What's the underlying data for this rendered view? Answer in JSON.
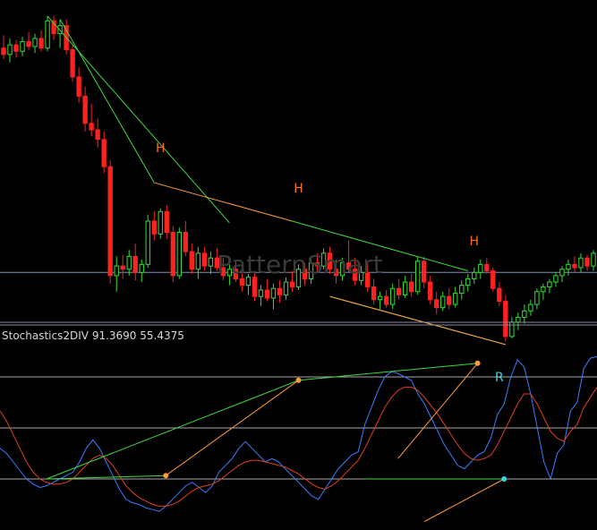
{
  "watermark": "PatternSmart",
  "colors": {
    "background": "#000000",
    "bull": "#33e033",
    "bear": "#ff2020",
    "divergence_green": "#3fdc3f",
    "divergence_orange": "#ff9a3c",
    "h_label": "#ff6a1a",
    "r_label": "#33d6e6",
    "stoch_main": "#3a7dff",
    "stoch_signal": "#e0401e",
    "level_line": "#c8c8c8",
    "separator": "#8a8aa8",
    "watermark": "#3a3a3a"
  },
  "chart_data": [
    {
      "type": "candlestick",
      "title": "",
      "xlabel": "",
      "ylabel": "",
      "ylim": [
        88,
        108
      ],
      "grid": false,
      "horizontal_line": 91.0,
      "candles": [
        [
          105.0,
          105.8,
          104.3,
          104.6
        ],
        [
          104.6,
          105.6,
          104.1,
          105.2
        ],
        [
          105.2,
          105.5,
          104.4,
          104.8
        ],
        [
          104.8,
          105.7,
          104.5,
          105.4
        ],
        [
          105.4,
          106.0,
          104.9,
          105.1
        ],
        [
          105.1,
          105.9,
          104.7,
          105.6
        ],
        [
          105.6,
          106.1,
          104.8,
          105.0
        ],
        [
          105.0,
          107.0,
          104.8,
          106.7
        ],
        [
          106.7,
          107.0,
          105.5,
          105.9
        ],
        [
          105.9,
          106.8,
          105.0,
          106.4
        ],
        [
          106.4,
          106.8,
          104.6,
          104.9
        ],
        [
          104.9,
          105.2,
          102.9,
          103.2
        ],
        [
          103.2,
          103.8,
          101.6,
          102.0
        ],
        [
          102.0,
          102.6,
          99.8,
          100.3
        ],
        [
          100.3,
          101.5,
          99.5,
          99.9
        ],
        [
          99.9,
          100.6,
          98.8,
          99.3
        ],
        [
          99.3,
          99.8,
          97.2,
          97.6
        ],
        [
          97.6,
          98.0,
          90.3,
          90.8
        ],
        [
          90.8,
          92.0,
          89.8,
          91.4
        ],
        [
          91.4,
          92.1,
          90.6,
          91.2
        ],
        [
          91.2,
          92.4,
          90.8,
          92.0
        ],
        [
          92.0,
          92.8,
          90.5,
          91.0
        ],
        [
          91.0,
          91.8,
          90.4,
          91.5
        ],
        [
          91.5,
          94.6,
          91.3,
          94.2
        ],
        [
          94.2,
          94.8,
          93.0,
          93.4
        ],
        [
          93.4,
          95.0,
          93.1,
          94.8
        ],
        [
          94.8,
          95.2,
          93.1,
          93.5
        ],
        [
          93.5,
          93.9,
          90.4,
          90.8
        ],
        [
          90.8,
          93.8,
          90.6,
          93.5
        ],
        [
          93.5,
          94.2,
          92.0,
          92.3
        ],
        [
          92.3,
          92.8,
          90.9,
          91.2
        ],
        [
          91.2,
          92.6,
          90.6,
          92.2
        ],
        [
          92.2,
          92.6,
          91.1,
          91.4
        ],
        [
          91.4,
          92.3,
          90.9,
          91.9
        ],
        [
          91.9,
          92.5,
          91.1,
          91.3
        ],
        [
          91.3,
          91.9,
          90.5,
          90.8
        ],
        [
          90.8,
          91.5,
          90.2,
          91.2
        ],
        [
          91.2,
          91.8,
          90.4,
          90.6
        ],
        [
          90.6,
          91.2,
          89.8,
          90.2
        ],
        [
          90.2,
          90.9,
          89.6,
          90.7
        ],
        [
          90.7,
          91.1,
          89.2,
          89.5
        ],
        [
          89.5,
          90.2,
          88.9,
          89.9
        ],
        [
          89.9,
          90.6,
          89.2,
          89.4
        ],
        [
          89.4,
          90.3,
          88.7,
          90.0
        ],
        [
          90.0,
          90.5,
          89.1,
          89.6
        ],
        [
          89.6,
          90.7,
          89.3,
          90.4
        ],
        [
          90.4,
          91.1,
          89.8,
          90.1
        ],
        [
          90.1,
          91.5,
          89.9,
          91.2
        ],
        [
          91.2,
          91.6,
          90.2,
          90.6
        ],
        [
          90.6,
          92.0,
          90.3,
          91.6
        ],
        [
          91.6,
          92.2,
          91.0,
          91.4
        ],
        [
          91.4,
          92.5,
          91.2,
          92.2
        ],
        [
          92.2,
          92.6,
          90.9,
          91.2
        ],
        [
          91.2,
          91.8,
          90.3,
          90.8
        ],
        [
          90.8,
          91.9,
          90.5,
          91.6
        ],
        [
          91.6,
          93.0,
          91.0,
          91.2
        ],
        [
          91.2,
          91.9,
          90.2,
          90.5
        ],
        [
          90.5,
          91.4,
          90.2,
          91.0
        ],
        [
          91.0,
          91.6,
          89.8,
          90.1
        ],
        [
          90.1,
          90.6,
          89.0,
          89.3
        ],
        [
          89.3,
          89.8,
          88.7,
          89.5
        ],
        [
          89.5,
          89.9,
          88.8,
          89.0
        ],
        [
          89.0,
          90.3,
          88.7,
          90.0
        ],
        [
          90.0,
          90.6,
          89.3,
          89.6
        ],
        [
          89.6,
          90.8,
          89.4,
          90.4
        ],
        [
          90.4,
          90.9,
          89.5,
          89.8
        ],
        [
          89.8,
          92.0,
          89.6,
          91.7
        ],
        [
          91.7,
          92.0,
          90.0,
          90.4
        ],
        [
          90.4,
          90.8,
          89.0,
          89.3
        ],
        [
          89.3,
          89.8,
          88.4,
          88.8
        ],
        [
          88.8,
          89.8,
          88.6,
          89.5
        ],
        [
          89.5,
          90.0,
          88.7,
          89.0
        ],
        [
          89.0,
          90.1,
          88.8,
          89.7
        ],
        [
          89.7,
          90.5,
          89.3,
          90.2
        ],
        [
          90.2,
          90.9,
          89.8,
          90.6
        ],
        [
          90.6,
          91.3,
          90.3,
          91.0
        ],
        [
          91.0,
          91.8,
          90.6,
          91.5
        ],
        [
          91.5,
          91.9,
          90.9,
          91.1
        ],
        [
          91.1,
          91.3,
          89.8,
          90.0
        ],
        [
          90.0,
          90.4,
          88.9,
          89.2
        ],
        [
          89.2,
          89.6,
          86.7,
          87.0
        ],
        [
          87.0,
          88.2,
          86.9,
          87.9
        ],
        [
          87.9,
          88.5,
          87.4,
          88.2
        ],
        [
          88.2,
          89.0,
          87.8,
          88.6
        ],
        [
          88.6,
          89.3,
          88.3,
          89.0
        ],
        [
          89.0,
          90.0,
          88.7,
          89.8
        ],
        [
          89.8,
          90.3,
          89.3,
          90.1
        ],
        [
          90.1,
          90.6,
          89.7,
          90.4
        ],
        [
          90.4,
          91.0,
          90.1,
          90.8
        ],
        [
          90.8,
          91.4,
          90.4,
          91.2
        ],
        [
          91.2,
          91.8,
          90.8,
          91.5
        ],
        [
          91.5,
          92.0,
          91.0,
          91.3
        ],
        [
          91.3,
          92.2,
          91.0,
          91.9
        ],
        [
          91.9,
          92.1,
          91.1,
          91.4
        ],
        [
          91.4,
          92.4,
          91.1,
          92.2
        ]
      ],
      "pattern_lines": [
        {
          "color": "green",
          "from": [
            7,
            107.0
          ],
          "to": [
            36,
            94.1
          ]
        },
        {
          "color": "green",
          "from": [
            9,
            106.8
          ],
          "to": [
            24,
            96.6
          ]
        },
        {
          "color": "green",
          "from": [
            46,
            94.2
          ],
          "to": [
            74,
            91.1
          ]
        },
        {
          "color": "green",
          "from": [
            52,
            89.5
          ],
          "to": [
            80,
            86.5
          ]
        },
        {
          "color": "orange",
          "from": [
            24,
            96.6
          ],
          "to": [
            46,
            94.2
          ]
        },
        {
          "color": "orange",
          "from": [
            52,
            89.5
          ],
          "to": [
            80,
            86.5
          ]
        }
      ],
      "annotations": [
        {
          "text": "H",
          "at": [
            25,
            98.5
          ],
          "color": "orange"
        },
        {
          "text": "H",
          "at": [
            47,
            96.0
          ],
          "color": "orange"
        },
        {
          "text": "H",
          "at": [
            75,
            92.7
          ],
          "color": "orange"
        },
        {
          "text": "R",
          "at": [
            79,
            84.2
          ],
          "color": "cyan"
        }
      ]
    },
    {
      "type": "line",
      "title": "Stochastics2DIV 91.3690 55.4375",
      "values_text": "91.3690 55.4375",
      "name_text": "Stochastics2DIV",
      "ylim": [
        -10,
        110
      ],
      "levels": [
        80,
        50,
        20
      ],
      "series": [
        {
          "color": "main",
          "values": [
            38,
            35,
            30,
            25,
            20,
            17,
            15,
            16,
            18,
            20,
            22,
            24,
            30,
            38,
            43,
            38,
            30,
            22,
            14,
            8,
            6,
            5,
            3,
            2,
            1,
            4,
            8,
            12,
            16,
            18,
            15,
            12,
            16,
            24,
            28,
            32,
            38,
            42,
            38,
            34,
            30,
            32,
            30,
            26,
            22,
            18,
            14,
            10,
            8,
            14,
            20,
            26,
            30,
            34,
            36,
            52,
            62,
            72,
            80,
            83,
            82,
            80,
            78,
            70,
            64,
            56,
            48,
            40,
            34,
            28,
            26,
            30,
            34,
            36,
            44,
            58,
            64,
            80,
            90,
            86,
            70,
            50,
            30,
            20,
            35,
            40,
            60,
            65,
            85,
            91,
            92
          ]
        },
        {
          "color": "signal",
          "values": [
            60,
            54,
            46,
            38,
            30,
            24,
            20,
            18,
            17,
            17,
            18,
            20,
            24,
            28,
            32,
            34,
            32,
            28,
            22,
            16,
            12,
            9,
            7,
            5,
            4,
            4,
            5,
            7,
            10,
            13,
            15,
            16,
            17,
            19,
            22,
            25,
            28,
            30,
            31,
            31,
            30,
            29,
            28,
            27,
            25,
            23,
            20,
            17,
            15,
            14,
            16,
            19,
            23,
            27,
            31,
            38,
            46,
            54,
            62,
            68,
            72,
            74,
            74,
            72,
            68,
            63,
            58,
            52,
            46,
            40,
            35,
            32,
            31,
            32,
            34,
            40,
            48,
            56,
            64,
            70,
            70,
            64,
            56,
            48,
            44,
            42,
            48,
            52,
            62,
            68,
            74
          ]
        }
      ],
      "divergence_lines": [
        {
          "color": "green",
          "from": [
            7,
            20
          ],
          "to": [
            45,
            78
          ]
        },
        {
          "color": "green",
          "from": [
            45,
            78
          ],
          "to": [
            72,
            88
          ]
        },
        {
          "color": "green",
          "from": [
            7,
            20
          ],
          "to": [
            25,
            22
          ]
        },
        {
          "color": "green",
          "from": [
            55,
            20
          ],
          "to": [
            76,
            20
          ]
        },
        {
          "color": "orange",
          "from": [
            25,
            22
          ],
          "to": [
            45,
            78
          ]
        },
        {
          "color": "orange",
          "from": [
            60,
            32
          ],
          "to": [
            72,
            88
          ]
        },
        {
          "color": "orange",
          "from": [
            64,
            -5
          ],
          "to": [
            76,
            20
          ]
        }
      ],
      "points": [
        {
          "at": [
            25,
            22
          ],
          "color": "orange"
        },
        {
          "at": [
            45,
            78
          ],
          "color": "orange"
        },
        {
          "at": [
            72,
            88
          ],
          "color": "orange"
        },
        {
          "at": [
            76,
            20
          ],
          "color": "cyan"
        }
      ]
    }
  ]
}
